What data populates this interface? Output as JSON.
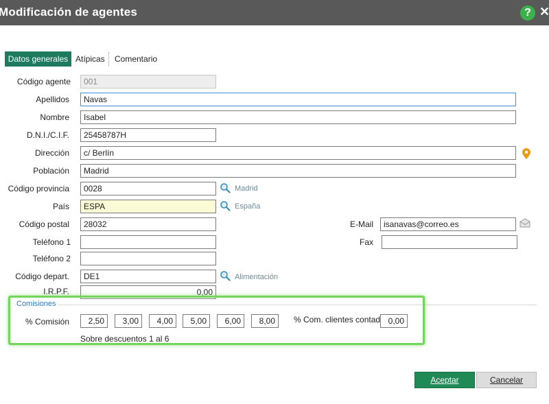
{
  "window": {
    "title": "Modificación de agentes"
  },
  "tabs": [
    {
      "label": "Datos generales",
      "active": true
    },
    {
      "label": "Atípicas",
      "active": false
    },
    {
      "label": "Comentario",
      "active": false
    }
  ],
  "form": {
    "codigo_agente": {
      "label": "Código agente",
      "value": "001"
    },
    "apellidos": {
      "label": "Apellidos",
      "value": "Navas"
    },
    "nombre": {
      "label": "Nombre",
      "value": "Isabel"
    },
    "dni": {
      "label": "D.N.I./C.I.F.",
      "value": "25458787H"
    },
    "direccion": {
      "label": "Dirección",
      "value": "c/ Berlín"
    },
    "poblacion": {
      "label": "Población",
      "value": "Madrid"
    },
    "codigo_provincia": {
      "label": "Código provincia",
      "value": "0028",
      "lookup": "Madrid"
    },
    "pais": {
      "label": "País",
      "value": "ESPA",
      "lookup": "España"
    },
    "codigo_postal": {
      "label": "Código postal",
      "value": "28032"
    },
    "email": {
      "label": "E-Mail",
      "value": "isanavas@correo.es"
    },
    "telefono1": {
      "label": "Teléfono 1",
      "value": ""
    },
    "fax": {
      "label": "Fax",
      "value": ""
    },
    "telefono2": {
      "label": "Teléfono 2",
      "value": ""
    },
    "codigo_depart": {
      "label": "Código depart.",
      "value": "DE1",
      "lookup": "Alimentación"
    },
    "irpf": {
      "label": "I.R.P.F.",
      "value": "0,00"
    }
  },
  "comisiones": {
    "group_title": "Comisiones",
    "label": "% Comisión",
    "values": [
      "2,50",
      "3,00",
      "4,00",
      "5,00",
      "6,00",
      "8,00"
    ],
    "contado_label": "% Com. clientes contado",
    "contado_value": "0,00",
    "note": "Sobre descuentos 1 al 6"
  },
  "buttons": {
    "accept": "Aceptar",
    "cancel": "Cancelar"
  },
  "colors": {
    "titlebar": "#595959",
    "accent": "#1e7a5f",
    "highlight": "#72d65a",
    "lookup_text": "#6f8a98"
  }
}
